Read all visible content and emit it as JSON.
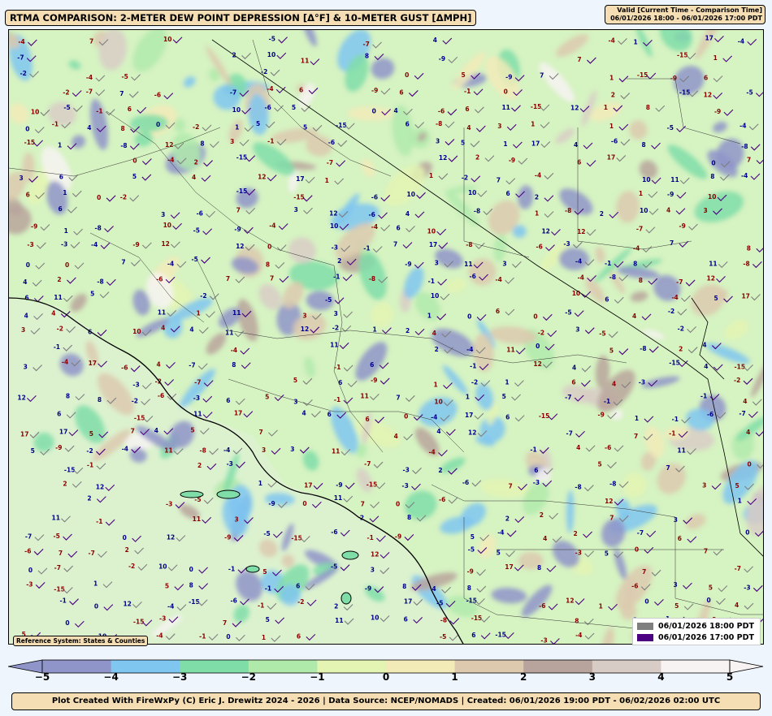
{
  "title": "RTMA COMPARISON: 2-METER DEW POINT DEPRESSION [Δ°F] & 10-METER GUST [ΔMPH]",
  "valid": {
    "line1": "Valid [Current Time - Comparison Time]",
    "line2": "06/01/2026 18:00 - 06/01/2026 17:00 PDT"
  },
  "reference_system": "Reference System: States & Counties",
  "legend": {
    "current": {
      "label": "06/01/2026 18:00 PDT",
      "color": "#7f7f7f"
    },
    "comparison": {
      "label": "06/01/2026 17:00 PDT",
      "color": "#4b0082"
    }
  },
  "colorbar": {
    "ticks": [
      "−5",
      "−4",
      "−3",
      "−2",
      "−1",
      "0",
      "1",
      "2",
      "3",
      "4",
      "5"
    ],
    "colors": [
      "#8f94c9",
      "#7fc6f0",
      "#7fdda8",
      "#b0eaab",
      "#e4f4b3",
      "#f2ebb8",
      "#dcc9ae",
      "#b8a49c",
      "#d8ccc6",
      "#f7f3f2"
    ]
  },
  "map": {
    "background_color": "#d6f3c2",
    "ocean_color": "#dcf2cf",
    "sample_values": [
      "0",
      "-1",
      "1",
      "-2",
      "2",
      "3",
      "-3",
      "4",
      "-4",
      "5",
      "-5",
      "-6",
      "6",
      "-8",
      "-9",
      "11",
      "-15",
      "17",
      "10",
      "12",
      "-7",
      "7",
      "8"
    ]
  },
  "footer": "Plot Created With FireWxPy (C) Eric J. Drewitz 2024 - 2026 | Data Source: NCEP/NOMADS | Created: 06/01/2026 19:00 PDT - 06/02/2026 02:00 UTC"
}
